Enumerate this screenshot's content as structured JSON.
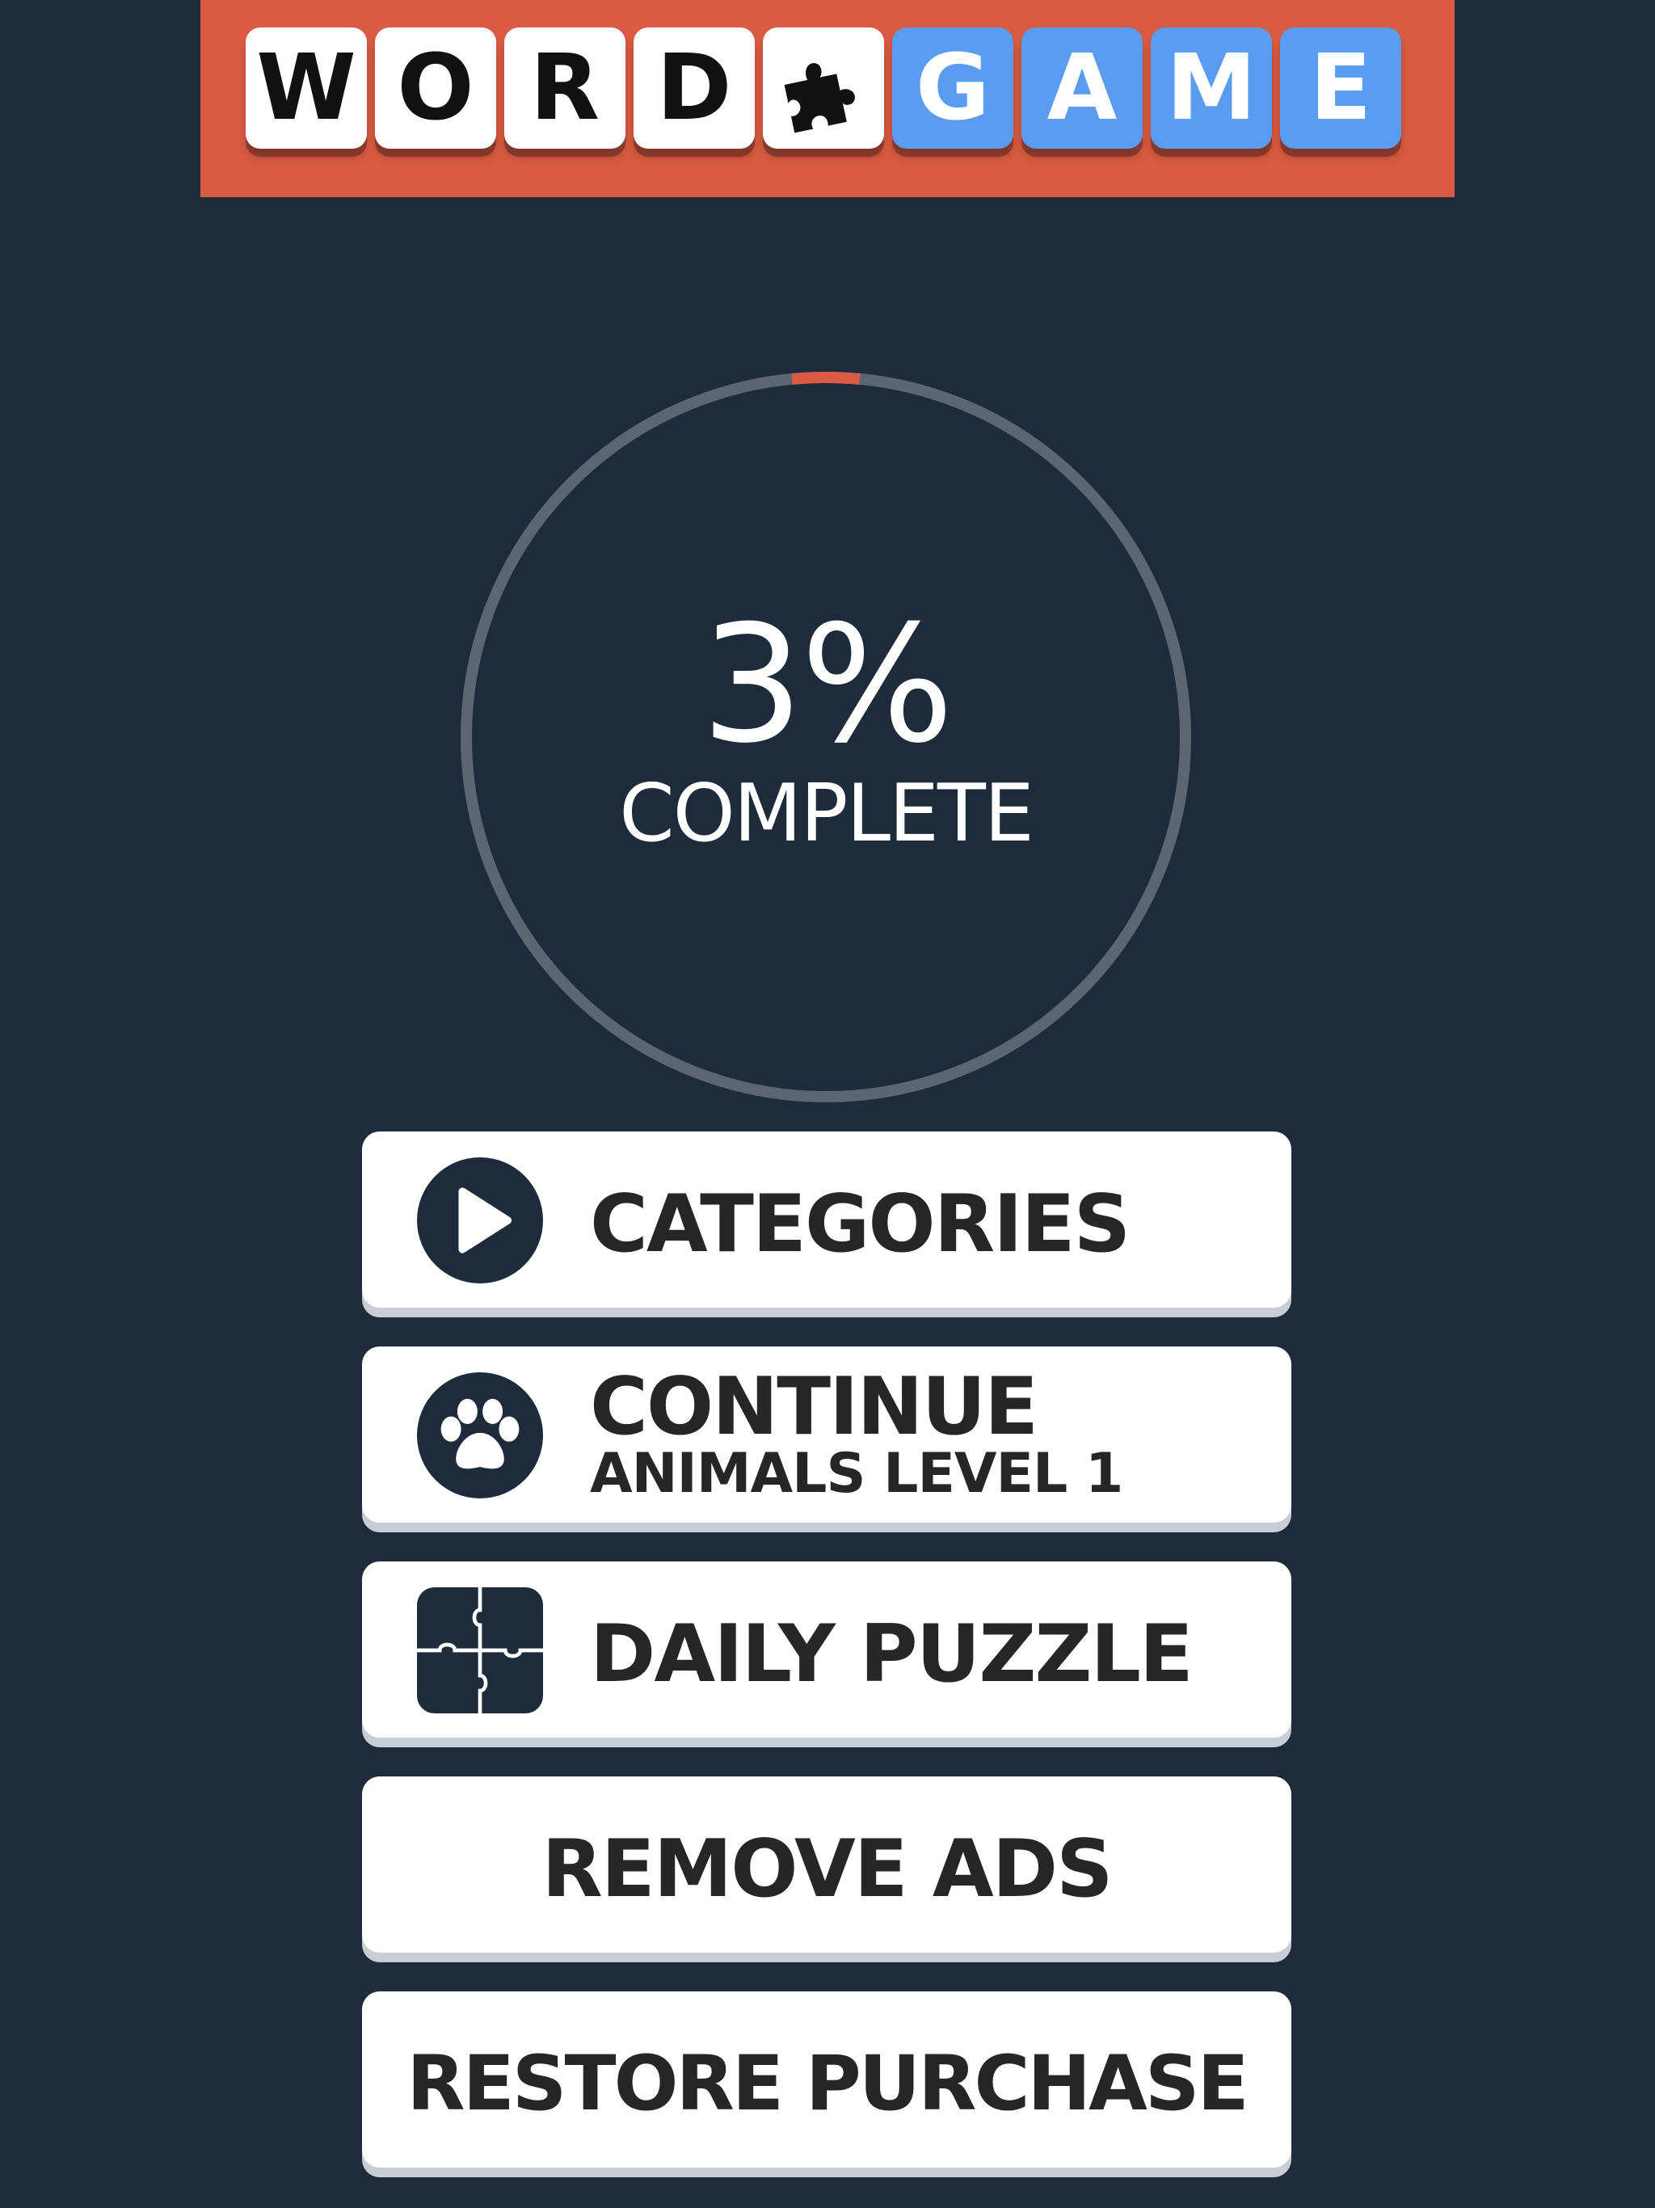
{
  "logo": {
    "word_letters": [
      "W",
      "O",
      "R",
      "D"
    ],
    "game_letters": [
      "G",
      "A",
      "M",
      "E"
    ],
    "puzzle_icon": "puzzle-piece-icon",
    "colors": {
      "banner": "#d95b43",
      "word_tile": "#ffffff",
      "game_tile": "#5a9cf0"
    }
  },
  "progress": {
    "value_percent": 3,
    "percent_label": "3%",
    "caption": "COMPLETE",
    "colors": {
      "track": "#5c6670",
      "fill": "#d95b43"
    }
  },
  "menu": {
    "categories": {
      "label": "CATEGORIES",
      "icon": "play-icon"
    },
    "continue": {
      "label": "CONTINUE",
      "sublabel": "ANIMALS LEVEL 1",
      "icon": "paw-icon"
    },
    "daily_puzzle": {
      "label": "DAILY PUZZLE",
      "icon": "puzzle-icon"
    },
    "remove_ads": {
      "label": "REMOVE ADS"
    },
    "restore_purchase": {
      "label": "RESTORE PURCHASE"
    }
  },
  "colors": {
    "background": "#1e2b3a",
    "button": "#ffffff",
    "button_text": "#262626"
  }
}
